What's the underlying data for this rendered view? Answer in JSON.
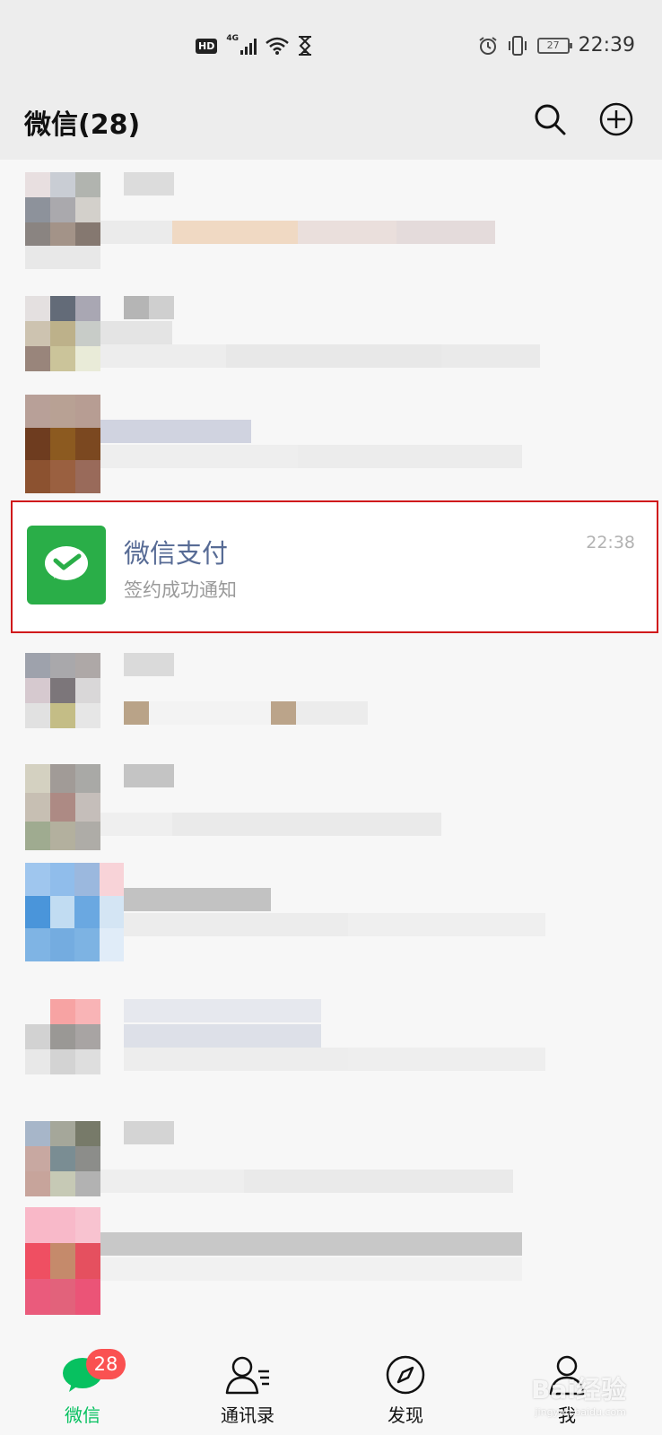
{
  "status_bar": {
    "hd": "HD",
    "network": "4G",
    "battery": "27",
    "time": "22:39",
    "icons": [
      "signal-icon",
      "wifi-icon",
      "hourglass-icon",
      "alarm-icon",
      "vibrate-icon",
      "battery-icon"
    ]
  },
  "header": {
    "title": "微信(28)",
    "search_icon": "search-icon",
    "add_icon": "add-circle-icon"
  },
  "highlighted_chat": {
    "name": "微信支付",
    "message": "签约成功通知",
    "time": "22:38",
    "avatar_icon": "wechat-pay-icon",
    "avatar_color": "#2aae48",
    "highlight_color": "#d0191b"
  },
  "tabbar": {
    "tabs": [
      {
        "label": "微信",
        "icon": "chat-bubble-icon",
        "badge": "28",
        "active": true
      },
      {
        "label": "通讯录",
        "icon": "contacts-icon"
      },
      {
        "label": "发现",
        "icon": "compass-icon"
      },
      {
        "label": "我",
        "icon": "person-icon"
      }
    ],
    "active_color": "#07c160",
    "badge_color": "#fa5151"
  },
  "watermark": {
    "brand": "Bai经验",
    "url": "jingyan.baidu.com"
  }
}
